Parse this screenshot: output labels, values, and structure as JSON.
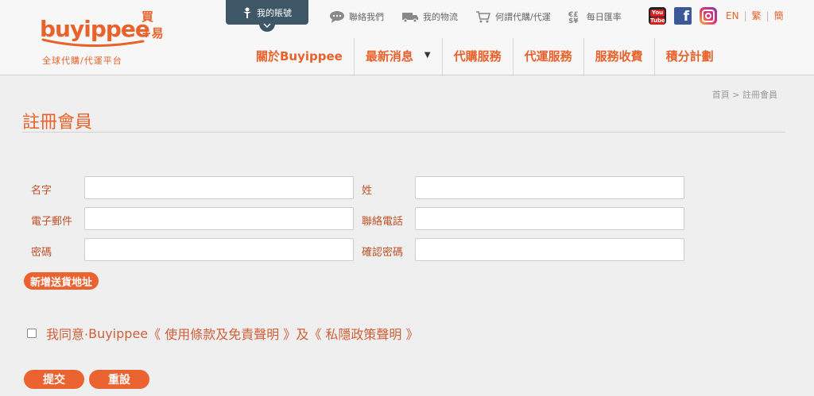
{
  "logo": {
    "cn_mark": "買+易",
    "wordmark": "buyippee",
    "tagline": "全球代購/代運平台"
  },
  "account": {
    "label": "我的賬號"
  },
  "top_links": [
    {
      "label": "聯絡我們",
      "icon": "chat-icon"
    },
    {
      "label": "我的物流",
      "icon": "truck-icon"
    },
    {
      "label": "何謂代購/代運",
      "icon": "cart-icon"
    },
    {
      "label": "每日匯率",
      "icon": "exchange-icon"
    }
  ],
  "social": {
    "youtube_top": "You",
    "youtube_bottom": "Tube",
    "facebook": "f"
  },
  "languages": [
    "EN",
    "繁",
    "簡"
  ],
  "nav": [
    {
      "label": "關於Buyippee"
    },
    {
      "label": "最新消息"
    },
    {
      "label": "代購服務"
    },
    {
      "label": "代運服務"
    },
    {
      "label": "服務收費"
    },
    {
      "label": "積分計劃"
    }
  ],
  "breadcrumb": {
    "home": "首頁",
    "separator": ">",
    "current": "註冊會員"
  },
  "page_title": "註冊會員",
  "form": {
    "first_name_label": "名字",
    "last_name_label": "姓",
    "email_label": "電子郵件",
    "phone_label": "聯絡電話",
    "password_label": "密碼",
    "confirm_password_label": "確認密碼",
    "first_name_value": "",
    "last_name_value": "",
    "email_value": "",
    "phone_value": "",
    "password_value": "",
    "confirm_password_value": "",
    "add_address_label": "新增送貨地址"
  },
  "agreement": {
    "prefix": "我同意·",
    "brand": "Buyippee",
    "terms_link": "《 使用條款及免責聲明 》",
    "joiner": "及",
    "privacy_link": "《 私隱政策聲明 》",
    "checked": false
  },
  "actions": {
    "submit_label": "提交",
    "reset_label": "重設"
  }
}
